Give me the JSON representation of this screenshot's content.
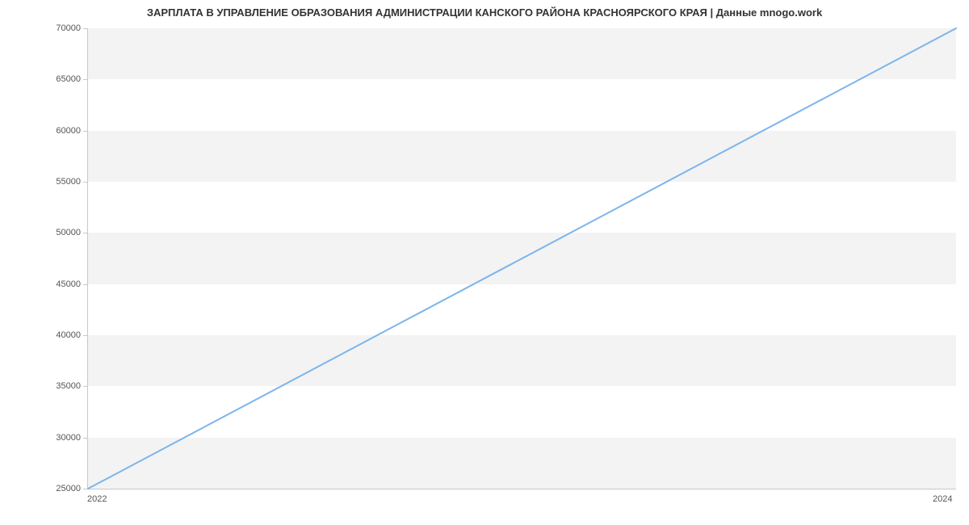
{
  "chart_data": {
    "type": "line",
    "title": "ЗАРПЛАТА В УПРАВЛЕНИЕ ОБРАЗОВАНИЯ АДМИНИСТРАЦИИ КАНСКОГО РАЙОНА КРАСНОЯРСКОГО КРАЯ | Данные mnogo.work",
    "x": [
      2022,
      2024
    ],
    "values": [
      25000,
      70000
    ],
    "xlabel": "",
    "ylabel": "",
    "x_ticks": [
      2022,
      2024
    ],
    "y_ticks": [
      25000,
      30000,
      35000,
      40000,
      45000,
      50000,
      55000,
      60000,
      65000,
      70000
    ],
    "ylim": [
      25000,
      70000
    ],
    "xlim": [
      2022,
      2024
    ],
    "line_color": "#7cb5ec",
    "grid_bands": true
  }
}
